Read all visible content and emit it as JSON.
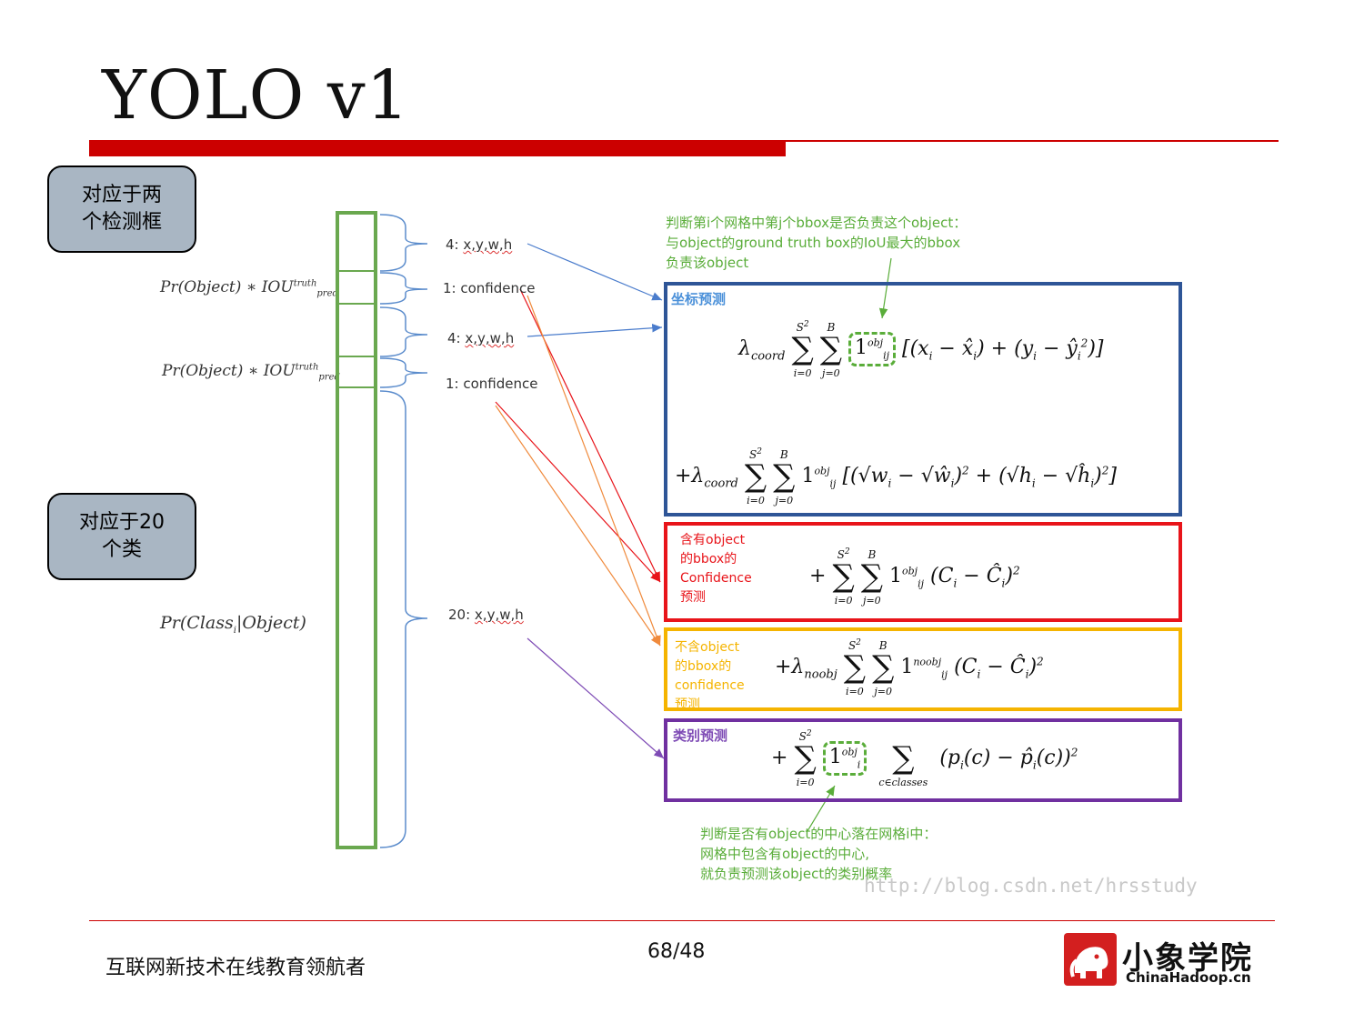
{
  "title": "YOLO v1",
  "callouts": {
    "two_boxes": "对应于两\n个检测框",
    "twenty_classes": "对应于20\n个类"
  },
  "left_math": {
    "pr_object_iou_1": "Pr(Object) ∗ IOU",
    "pr_object_iou_2": "Pr(Object) ∗ IOU",
    "iou_sup": "truth",
    "iou_sub": "pred",
    "pr_class": "Pr(Class",
    "pr_class_sub": "i",
    "pr_class_tail": "|Object)"
  },
  "vector_labels": {
    "l1_count": "4: ",
    "l1_text": "x,y,w,h",
    "l2": "1: confidence",
    "l3_count": "4: ",
    "l3_text": "x,y,w,h",
    "l4": "1: confidence",
    "l5_count": "20: ",
    "l5_text": "x,y,w,h"
  },
  "notes": {
    "top_green": "判断第i个网格中第j个bbox是否负责这个object：\n与object的ground truth box的IoU最大的bbox\n负责该object",
    "bottom_green": "判断是否有object的中心落在网格i中：\n网格中包含有object的中心,\n就负责预测该object的类别概率"
  },
  "boxes": {
    "coord": {
      "title": "坐标预测",
      "color": "#2e5597"
    },
    "obj_conf": {
      "note": "含有object\n的bbox的\nConfidence\n预测",
      "color": "#e8141a"
    },
    "noobj_conf": {
      "note": "不含object\n的bbox的\nconfidence\n预测",
      "color": "#f5b400"
    },
    "class": {
      "title": "类别预测",
      "color": "#7030a0"
    }
  },
  "colors": {
    "accent_red": "#cc0000",
    "vector_green": "#6aa84f",
    "arrow_blue": "#4a7ccc",
    "arrow_red": "#e8141a",
    "arrow_orange": "#f08a3c",
    "arrow_purple": "#7e4bb5",
    "note_green": "#5aad3a"
  },
  "watermark": "http://blog.csdn.net/hrsstudy",
  "footer": {
    "slogan": "互联网新技术在线教育领航者",
    "page": "68/48",
    "logo_cn": "小象学院",
    "logo_en": "ChinaHadoop.cn"
  }
}
